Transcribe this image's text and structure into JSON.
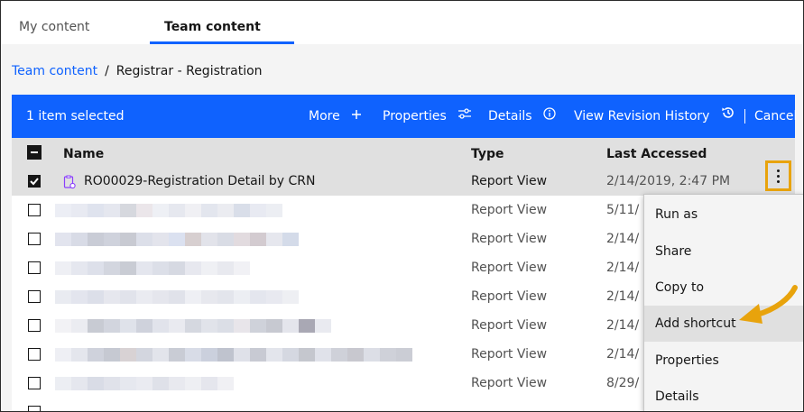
{
  "tabs": [
    {
      "label": "My content",
      "active": false
    },
    {
      "label": "Team content",
      "active": true
    }
  ],
  "breadcrumb": {
    "link": "Team content",
    "separator": "/",
    "current": "Registrar - Registration"
  },
  "actionbar": {
    "selection": "1 item selected",
    "more": "More",
    "properties": "Properties",
    "details": "Details",
    "revision": "View Revision History",
    "cancel": "Cancel",
    "color": "#0f62fe"
  },
  "table": {
    "headers": {
      "name": "Name",
      "type": "Type",
      "last_accessed": "Last Accessed"
    },
    "rows": [
      {
        "name": "RO00029-Registration Detail by CRN",
        "type": "Report View",
        "last_accessed": "2/14/2019, 2:47 PM",
        "selected": true
      },
      {
        "name": "",
        "type": "Report View",
        "last_accessed": "5/11/",
        "selected": false
      },
      {
        "name": "",
        "type": "Report View",
        "last_accessed": "2/14/",
        "selected": false
      },
      {
        "name": "",
        "type": "Report View",
        "last_accessed": "2/14/",
        "selected": false
      },
      {
        "name": "",
        "type": "Report View",
        "last_accessed": "2/14/",
        "selected": false
      },
      {
        "name": "",
        "type": "Report View",
        "last_accessed": "2/14/",
        "selected": false
      },
      {
        "name": "",
        "type": "Report View",
        "last_accessed": "2/14/",
        "selected": false
      },
      {
        "name": "",
        "type": "Report View",
        "last_accessed": "8/29/",
        "selected": false
      }
    ]
  },
  "context_menu": {
    "items": [
      "Run as",
      "Share",
      "Copy to",
      "Add shortcut",
      "Properties",
      "Details"
    ],
    "highlighted": "Add shortcut"
  },
  "annotation": {
    "highlight_color": "#e8a30c"
  }
}
